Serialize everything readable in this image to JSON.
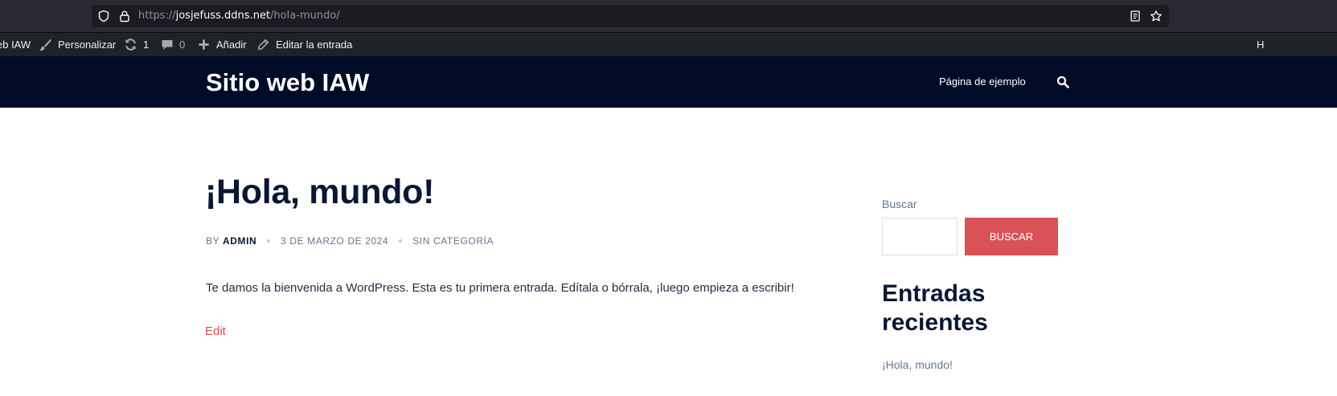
{
  "browser": {
    "url_scheme": "https://",
    "url_host": "josjefuss.ddns.net",
    "url_path": "/hola-mundo/",
    "icons": [
      "shield-icon",
      "lock-icon",
      "reader-view-icon",
      "bookmark-star-icon"
    ]
  },
  "adminbar": {
    "site_name_partial": "eb IAW",
    "customize_label": "Personalizar",
    "updates_count": "1",
    "comments_count": "0",
    "add_label": "Añadir",
    "edit_post_label": "Editar la entrada",
    "right_partial": "H"
  },
  "header": {
    "site_title": "Sitio web IAW",
    "nav_item": "Página de ejemplo"
  },
  "post": {
    "title": "¡Hola, mundo!",
    "by_label": "BY",
    "author": "ADMIN",
    "date": "3 DE MARZO DE 2024",
    "category": "SIN CATEGORÍA",
    "body": "Te damos la bienvenida a WordPress. Esta es tu primera entrada. Edítala o bórrala, ¡luego empieza a escribir!",
    "edit_label": "Edit"
  },
  "sidebar": {
    "search_label": "Buscar",
    "search_button": "BUSCAR",
    "recent_title": "Entradas recientes",
    "recent_items": [
      "¡Hola, mundo!"
    ]
  },
  "colors": {
    "header_bg": "#000c27",
    "adminbar_bg": "#1d2327",
    "accent": "#d95356",
    "title_text": "#0a1733"
  }
}
